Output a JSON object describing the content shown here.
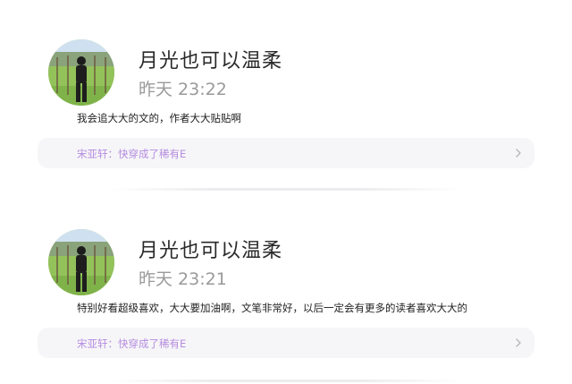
{
  "comments": [
    {
      "user_name": "月光也可以温柔",
      "time": "昨天 23:22",
      "text": "我会追大大的文的，作者大大贴贴啊",
      "book_ref": "宋亚轩：快穿成了稀有E"
    },
    {
      "user_name": "月光也可以温柔",
      "time": "昨天 23:21",
      "text": "特别好看超级喜欢，大大要加油啊，文笔非常好，以后一定会有更多的读者喜欢大大的",
      "book_ref": "宋亚轩：快穿成了稀有E"
    }
  ],
  "colors": {
    "accent_link": "#b58be0",
    "name": "#2a2a2a",
    "time": "#9a9a9a"
  },
  "icons": [
    "avatar-photo",
    "chevron-right-icon"
  ]
}
